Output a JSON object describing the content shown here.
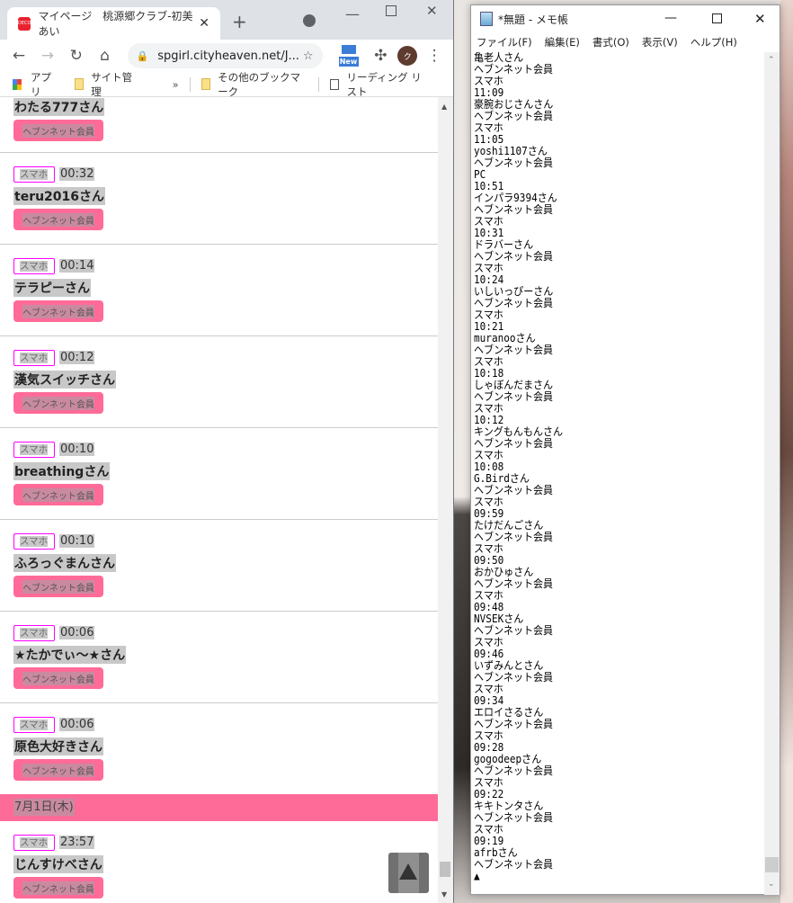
{
  "browser": {
    "tab_title": "マイページ　桃源郷クラブ-初美 あい",
    "favicon_text": "DECO",
    "url": "spgirl.cityheaven.net/J...",
    "new_badge": "New",
    "avatar_letter": "ク",
    "bookmarks": [
      "アプリ",
      "サイト管理",
      "その他のブックマーク",
      "リーディング リスト"
    ],
    "bookmarks_overflow": "»"
  },
  "page": {
    "partial_entry": {
      "name": "わたる777さん",
      "badge": "ヘブンネット会員"
    },
    "entries": [
      {
        "device": "スマホ",
        "time": "00:32",
        "name": "teru2016さん",
        "badge": "ヘブンネット会員"
      },
      {
        "device": "スマホ",
        "time": "00:14",
        "name": "テラピーさん",
        "badge": "ヘブンネット会員"
      },
      {
        "device": "スマホ",
        "time": "00:12",
        "name": "漢気スイッチさん",
        "badge": "ヘブンネット会員"
      },
      {
        "device": "スマホ",
        "time": "00:10",
        "name": "breathingさん",
        "badge": "ヘブンネット会員"
      },
      {
        "device": "スマホ",
        "time": "00:10",
        "name": "ふろっぐまんさん",
        "badge": "ヘブンネット会員"
      },
      {
        "device": "スマホ",
        "time": "00:06",
        "name": "★たかでぃ～★さん",
        "badge": "ヘブンネット会員"
      },
      {
        "device": "スマホ",
        "time": "00:06",
        "name": "原色大好きさん",
        "badge": "ヘブンネット会員"
      }
    ],
    "date_header": "7月1日(木)",
    "after_date": [
      {
        "device": "スマホ",
        "time": "23:57",
        "name": "じんすけべさん",
        "badge": "ヘブンネット会員"
      }
    ]
  },
  "notepad": {
    "title": "*無題 - メモ帳",
    "menu": [
      "ファイル(F)",
      "編集(E)",
      "書式(O)",
      "表示(V)",
      "ヘルプ(H)"
    ],
    "lines": [
      "亀老人さん",
      "ヘブンネット会員",
      "スマホ",
      "11:09",
      "豪腕おじさんさん",
      "ヘブンネット会員",
      "スマホ",
      "11:05",
      "yoshi1107さん",
      "ヘブンネット会員",
      "PC",
      "10:51",
      "インパラ9394さん",
      "ヘブンネット会員",
      "スマホ",
      "10:31",
      "ドラバーさん",
      "ヘブンネット会員",
      "スマホ",
      "10:24",
      "いしいっぴーさん",
      "ヘブンネット会員",
      "スマホ",
      "10:21",
      "muranooさん",
      "ヘブンネット会員",
      "スマホ",
      "10:18",
      "しゃぼんだまさん",
      "ヘブンネット会員",
      "スマホ",
      "10:12",
      "キングもんもんさん",
      "ヘブンネット会員",
      "スマホ",
      "10:08",
      "G.Birdさん",
      "ヘブンネット会員",
      "スマホ",
      "09:59",
      "たけだんごさん",
      "ヘブンネット会員",
      "スマホ",
      "09:50",
      "おかひゅさん",
      "ヘブンネット会員",
      "スマホ",
      "09:48",
      "NVSEKさん",
      "ヘブンネット会員",
      "スマホ",
      "09:46",
      "いずみんとさん",
      "ヘブンネット会員",
      "スマホ",
      "09:34",
      "エロイさるさん",
      "ヘブンネット会員",
      "スマホ",
      "09:28",
      "gogodeepさん",
      "ヘブンネット会員",
      "スマホ",
      "09:22",
      "キキトンタさん",
      "ヘブンネット会員",
      "スマホ",
      "09:19",
      "afrbさん",
      "ヘブンネット会員",
      "▲"
    ]
  },
  "colors": {
    "accent_pink": "#ff6b98",
    "device_border": "#ff00ff"
  }
}
